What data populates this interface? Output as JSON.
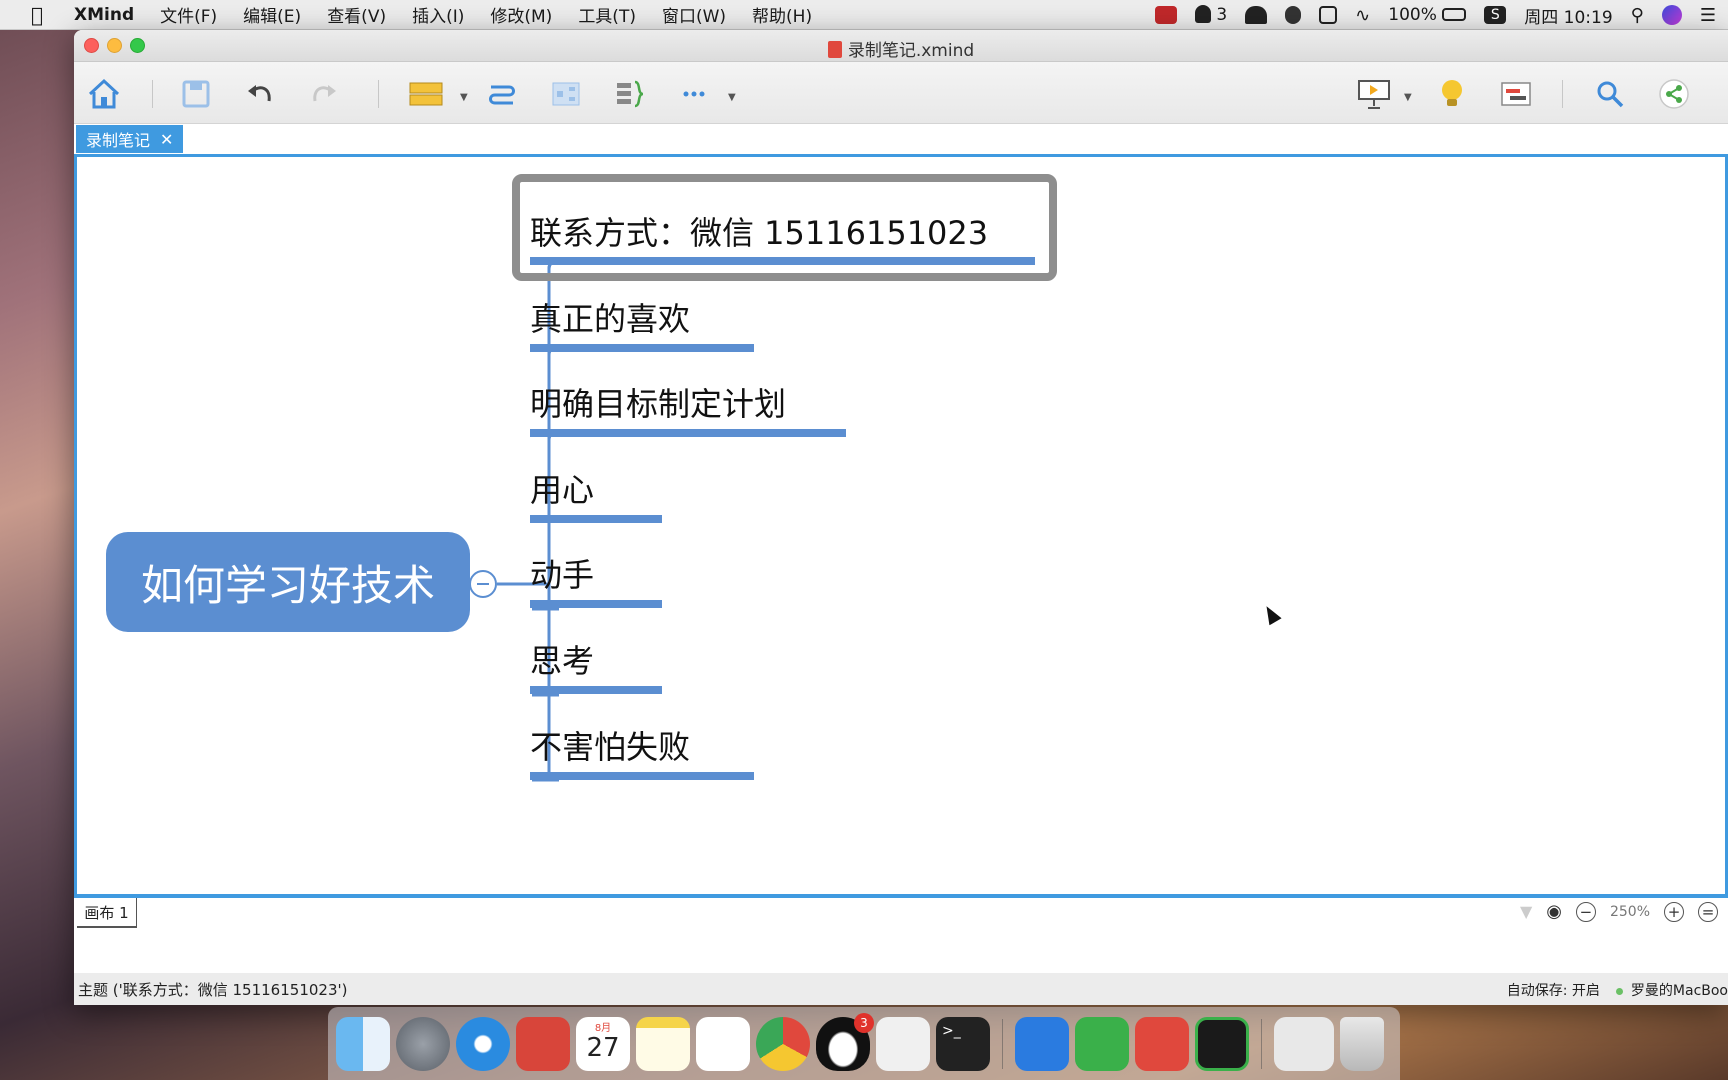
{
  "menubar": {
    "app_name": "XMind",
    "items": [
      "文件(F)",
      "编辑(E)",
      "查看(V)",
      "插入(I)",
      "修改(M)",
      "工具(T)",
      "窗口(W)",
      "帮助(H)"
    ],
    "qq_count": "3",
    "battery": "100%",
    "clock": "周四 10:19"
  },
  "window": {
    "title": "录制笔记.xmind",
    "doc_tab": "录制笔记"
  },
  "mindmap": {
    "central_topic": "如何学习好技术",
    "topics": [
      "联系方式：微信  15116151023",
      "真正的喜欢",
      "明确目标制定计划",
      "用心",
      "动手",
      "思考",
      "不害怕失败"
    ],
    "selected_index": 0,
    "accent_color": "#5b8ed1"
  },
  "sheetbar": {
    "sheet_tab": "画布 1",
    "zoom": "250%"
  },
  "statusbar": {
    "selection": "主题 ('联系方式：微信  15116151023')",
    "autosave": "自动保存: 开启",
    "user": "罗曼的MacBoo"
  },
  "dock": {
    "calendar_month": "8月",
    "calendar_day": "27",
    "qq_badge": "3"
  },
  "colors": {
    "tab_blue": "#3f9ae0",
    "topic_blue": "#5b8ed1"
  }
}
